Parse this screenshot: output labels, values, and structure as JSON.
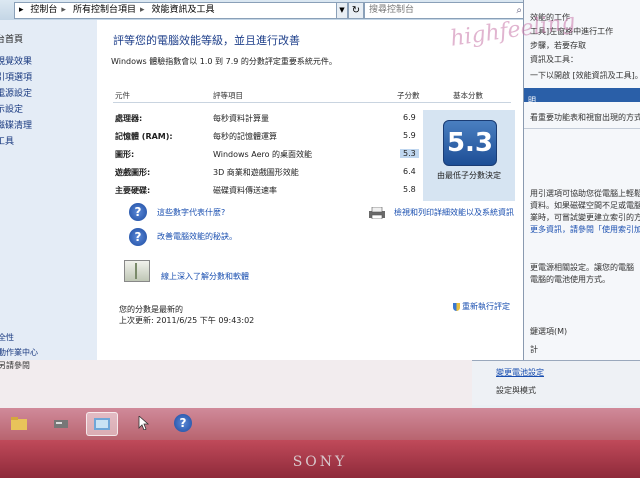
{
  "address_bar": {
    "crumbs": [
      "控制台",
      "所有控制台項目",
      "效能資訊及工具"
    ],
    "search_placeholder": "搜尋控制台"
  },
  "left_nav": {
    "home": "台首頁",
    "items": [
      "視覺效果",
      "引項選項",
      "電源設定",
      "示設定",
      "磁碟清理",
      "工具"
    ],
    "see_also": "另請參閱",
    "bottom": [
      "全性",
      "動作業中心"
    ]
  },
  "main": {
    "heading": "評等您的電腦效能等級，並且進行改善",
    "intro": "Windows 體驗指數會以 1.0 到 7.9 的分數評定重要系統元件。",
    "columns": {
      "component": "元件",
      "rated": "評等項目",
      "subscore": "子分數",
      "base": "基本分數"
    },
    "rows": [
      {
        "component": "處理器:",
        "desc": "每秒資料計算量",
        "subscore": "6.9"
      },
      {
        "component": "記憶體 (RAM):",
        "desc": "每秒的記憶體運算",
        "subscore": "5.9"
      },
      {
        "component": "圖形:",
        "desc": "Windows Aero 的桌面效能",
        "subscore": "5.3"
      },
      {
        "component": "遊戲圖形:",
        "desc": "3D 商業和遊戲圖形效能",
        "subscore": "6.4"
      },
      {
        "component": "主要硬碟:",
        "desc": "磁碟資料傳送速率",
        "subscore": "5.8"
      }
    ],
    "base_score": "5.3",
    "base_caption": "由最低子分數決定",
    "links": {
      "what_numbers": "這些數字代表什麼?",
      "improve": "改善電腦效能的秘訣。",
      "print": "檢視和列印詳細效能以及系統資訊",
      "online": "線上深入了解分數和軟體"
    },
    "score_current": "您的分數是最新的",
    "last_update": "上次更新: 2011/6/25 下午 09:43:02",
    "rerun": "重新執行評定"
  },
  "right_window": {
    "lines": [
      "效能的工作",
      "工具]左窗格中進行工作",
      "步驟，若要存取",
      "資訊及工具：",
      "一下以開啟 [效能資訊及工具]。",
      "明",
      "看重要功能表和視窗出現的方式",
      "用引選項可協助您從電腦上輕鬆迅",
      "資料。如果磁碟空間不足或電腦速",
      "業時，可嘗試變更建立索引的方式",
      "更多資訊，請參閱「使用索引加快",
      "更電源相關設定。讓您的電腦",
      "電腦的電池使用方式。",
      "鍵選項(M)",
      "計"
    ],
    "banner": "明",
    "bottom": [
      "變更電池設定",
      "設定與模式"
    ]
  },
  "watermark": "highfeeling",
  "bezel_brand": "SONY"
}
